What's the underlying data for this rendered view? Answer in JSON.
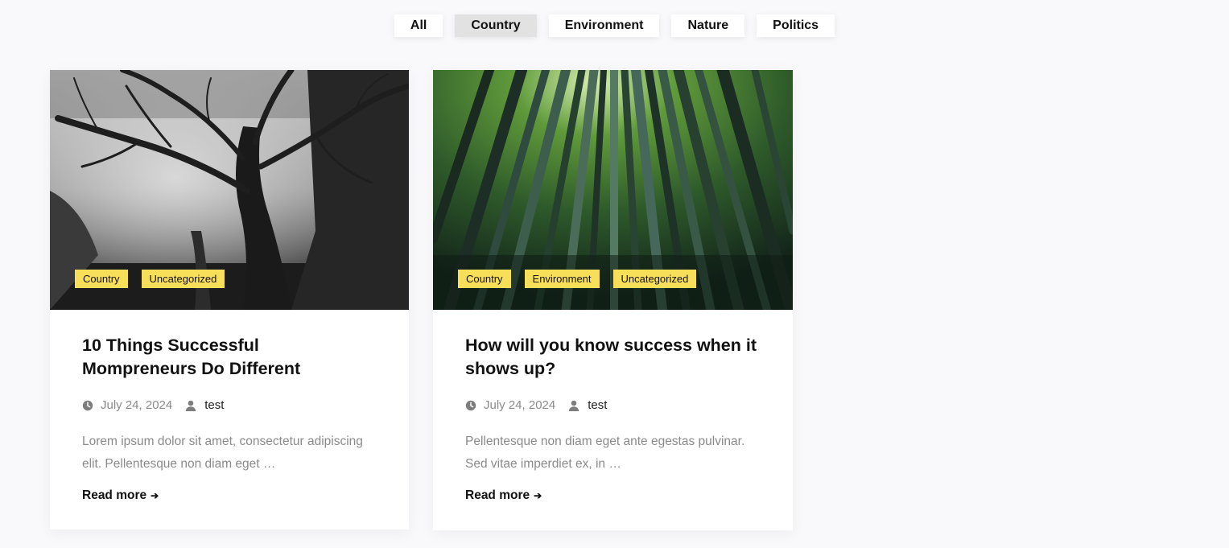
{
  "filters": {
    "items": [
      {
        "label": "All"
      },
      {
        "label": "Country"
      },
      {
        "label": "Environment"
      },
      {
        "label": "Nature"
      },
      {
        "label": "Politics"
      }
    ],
    "active": "Country"
  },
  "posts": [
    {
      "image": "black-and-white-forest-tree",
      "tags": [
        "Country",
        "Uncategorized"
      ],
      "title": "10 Things Successful Mompreneurs Do Different",
      "date": "July 24, 2024",
      "author": "test",
      "excerpt": "Lorem ipsum dolor sit amet, consectetur adipiscing elit. Pellentesque non diam eget …",
      "read_more": "Read more"
    },
    {
      "image": "bamboo-forest-from-below",
      "tags": [
        "Country",
        "Environment",
        "Uncategorized"
      ],
      "title": "How will you know success when it shows up?",
      "date": "July 24, 2024",
      "author": "test",
      "excerpt": "Pellentesque non diam eget ante egestas pulvinar. Sed vitae imperdiet ex, in …",
      "read_more": "Read more"
    }
  ],
  "colors": {
    "tag_background": "#f7df5a",
    "page_background": "#f9f9fb",
    "active_filter": "#e2e2e2"
  },
  "icons": {
    "date": "clock-icon",
    "author": "user-icon",
    "read_more": "arrow-right-icon"
  }
}
